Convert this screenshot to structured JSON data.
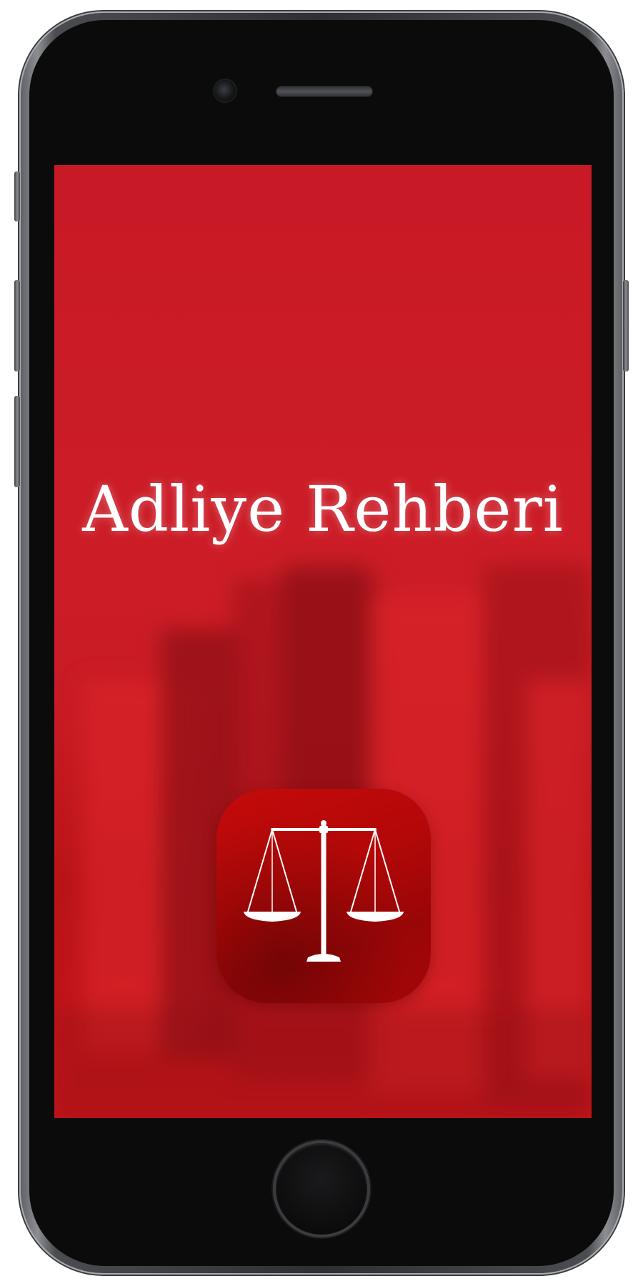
{
  "app": {
    "title": "Adliye Rehberi"
  },
  "icon": {
    "semantic": "scales-of-justice-icon"
  },
  "colors": {
    "background_red": "#c81a26",
    "icon_red": "#b30808",
    "title_text": "#ffffff",
    "device_bezel": "#0b0b0c"
  }
}
